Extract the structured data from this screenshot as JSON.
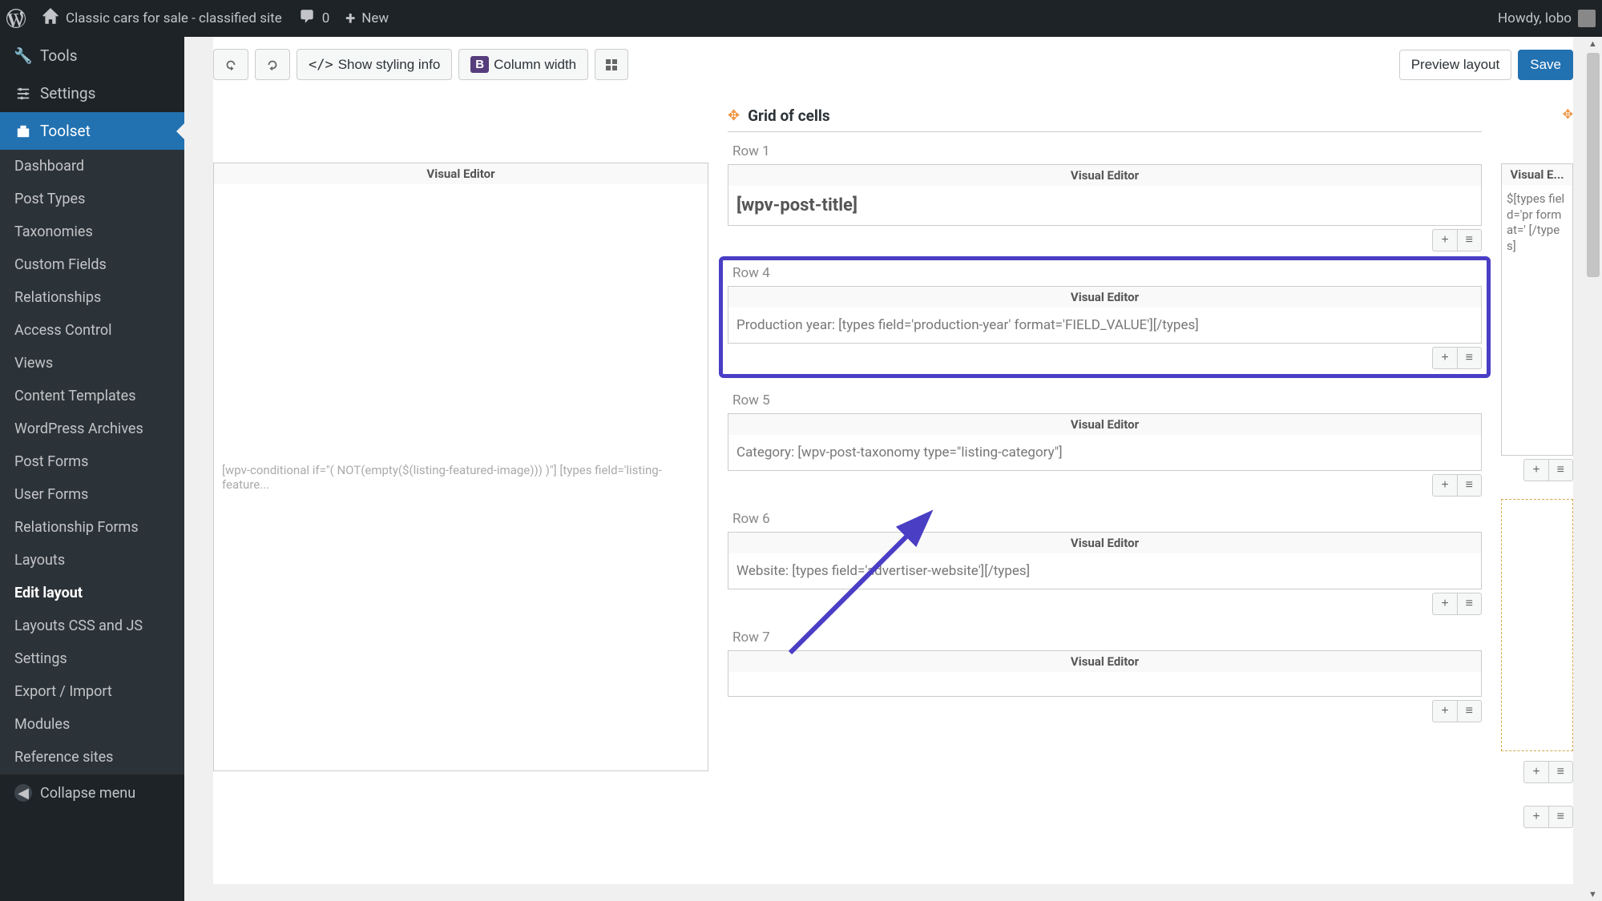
{
  "adminBar": {
    "siteTitle": "Classic cars for sale - classified site",
    "commentsCount": "0",
    "newLabel": "New",
    "greeting": "Howdy, lobo"
  },
  "sidebar": {
    "tools": "Tools",
    "settings": "Settings",
    "toolset": "Toolset",
    "submenu": [
      "Dashboard",
      "Post Types",
      "Taxonomies",
      "Custom Fields",
      "Relationships",
      "Access Control",
      "Views",
      "Content Templates",
      "WordPress Archives",
      "Post Forms",
      "User Forms",
      "Relationship Forms",
      "Layouts",
      "Edit layout",
      "Layouts CSS and JS",
      "Settings",
      "Export / Import",
      "Modules",
      "Reference sites"
    ],
    "collapse": "Collapse menu"
  },
  "toolbar": {
    "showStyling": "Show styling info",
    "columnWidth": "Column width",
    "preview": "Preview layout",
    "save": "Save"
  },
  "grid": {
    "title": "Grid of cells",
    "visEditor": "Visual Editor",
    "visEditorShort": "Visual E...",
    "leftCell": "[wpv-conditional if=\"( NOT(empty($(listing-featured-image))) )\"] [types field='listing-feature...",
    "row1": {
      "label": "Row 1",
      "content": "[wpv-post-title]"
    },
    "row4": {
      "label": "Row 4",
      "content": "Production year: [types field='production-year' format='FIELD_VALUE'][/types]"
    },
    "row5": {
      "label": "Row 5",
      "content": "Category: [wpv-post-taxonomy type=\"listing-category\"]"
    },
    "row6": {
      "label": "Row 6",
      "content": "Website: [types field='advertiser-website'][/types]"
    },
    "row7": {
      "label": "Row 7",
      "content": ""
    },
    "rightCell": "$[types field='pr format=' [/types]"
  }
}
